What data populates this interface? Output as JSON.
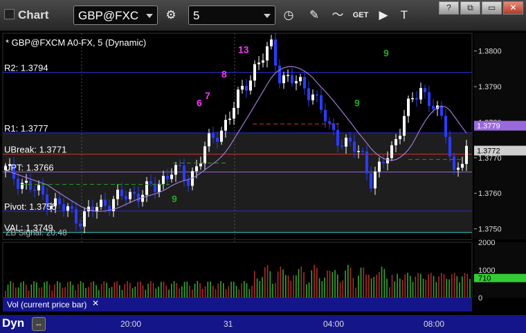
{
  "toolbar": {
    "title": "Chart",
    "symbol": "GBP@FXC",
    "interval": "5",
    "icons": [
      "gear-icon",
      "clock-icon",
      "pencil-icon",
      "indicator-icon",
      "get-icon",
      "play-icon",
      "text-icon"
    ],
    "window_buttons": [
      "?",
      "⧉",
      "▭",
      "✕"
    ]
  },
  "chart": {
    "header": "* GBP@FXCM A0-FX, 5 (Dynamic)",
    "levels": [
      {
        "label": "R2: 1.3794",
        "price": 1.3794,
        "color": "#2b2bd6"
      },
      {
        "label": "R1: 1.3777",
        "price": 1.3777,
        "color": "#2b2bd6"
      },
      {
        "label": "UBreak: 1.3771",
        "price": 1.3771,
        "color": "#e03030"
      },
      {
        "label": "UPT: 1.3766",
        "price": 1.3766,
        "color": "#9a6adc"
      },
      {
        "label": "Pivot: 1.3755",
        "price": 1.3755,
        "color": "#2b2bd6"
      },
      {
        "label": "VAL: 1.3749",
        "price": 1.3749,
        "color": "#2bd6d6"
      }
    ],
    "price_ticks": [
      "1.3800",
      "1.3790",
      "1.3780",
      "1.3770",
      "1.3760",
      "1.3750"
    ],
    "last_price": "1.3772",
    "ma_price": "1.3779",
    "signal_label": "ZB Signal: 20.48",
    "ylim": [
      1.3747,
      1.3805
    ],
    "seq_labels": [
      {
        "text": "8",
        "color": "#ff33ff",
        "i": 52,
        "price": 1.37925
      },
      {
        "text": "7",
        "color": "#ff33ff",
        "i": 48,
        "price": 1.37865
      },
      {
        "text": "6",
        "color": "#ff33ff",
        "i": 46,
        "price": 1.37845
      },
      {
        "text": "13",
        "color": "#ff33ff",
        "i": 56,
        "price": 1.37995
      },
      {
        "text": "9",
        "color": "#22aa22",
        "i": 91,
        "price": 1.37985
      },
      {
        "text": "9",
        "color": "#22aa22",
        "i": 84,
        "price": 1.37845
      },
      {
        "text": "9",
        "color": "#22aa22",
        "i": 40,
        "price": 1.37575
      }
    ]
  },
  "volume": {
    "label": "Vol (current price bar)",
    "ticks": [
      "2000",
      "1000",
      "0"
    ],
    "current": "710",
    "ylim": [
      0,
      2000
    ]
  },
  "xaxis": {
    "labels": [
      {
        "text": "20:00",
        "x": 190
      },
      {
        "text": "31",
        "x": 339
      },
      {
        "text": "04:00",
        "x": 483
      },
      {
        "text": "08:00",
        "x": 628
      }
    ]
  },
  "status": {
    "mode": "Dyn"
  }
}
